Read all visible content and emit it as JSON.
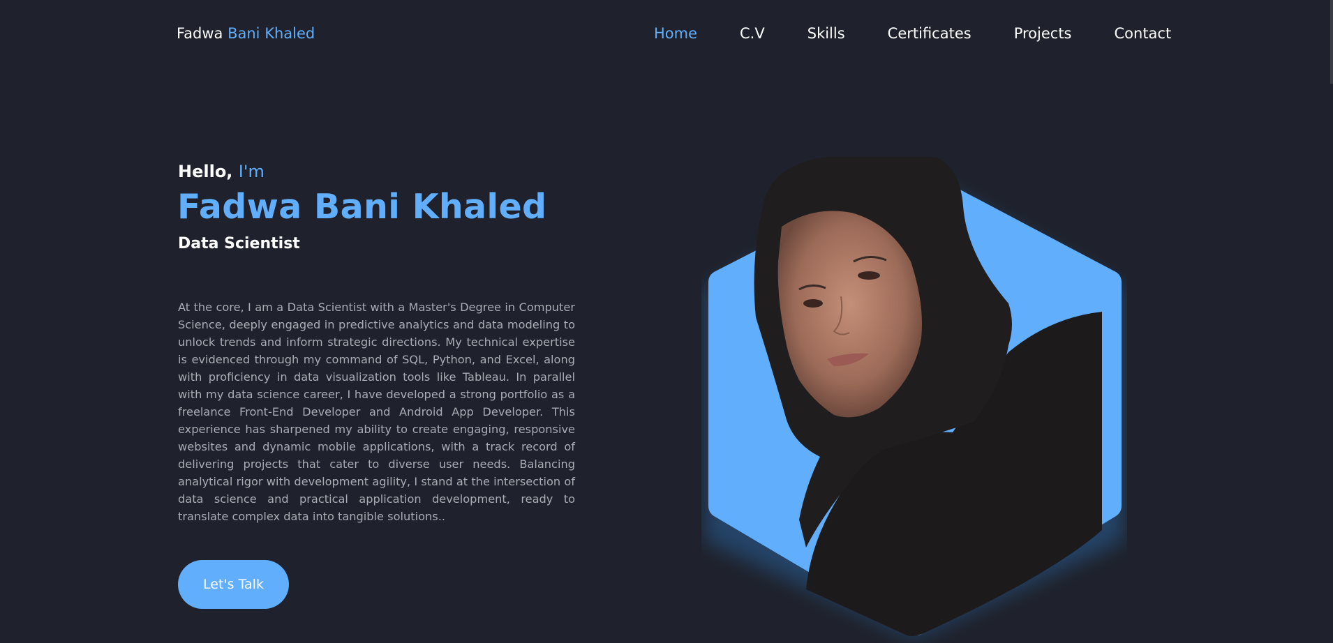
{
  "header": {
    "logo_first": "Fadwa",
    "logo_accent": "Bani Khaled"
  },
  "nav": {
    "items": [
      {
        "label": "Home",
        "active": true
      },
      {
        "label": "C.V",
        "active": false
      },
      {
        "label": "Skills",
        "active": false
      },
      {
        "label": "Certificates",
        "active": false
      },
      {
        "label": "Projects",
        "active": false
      },
      {
        "label": "Contact",
        "active": false
      }
    ]
  },
  "hero": {
    "greeting": "Hello,",
    "greeting_accent": "I'm",
    "name": "Fadwa Bani Khaled",
    "role": "Data Scientist",
    "about": "At the core, I am a Data Scientist with a Master's Degree in Computer Science, deeply engaged in predictive analytics and data modeling to unlock trends and inform strategic directions. My technical expertise is evidenced through my command of SQL, Python, and Excel, along with proficiency in data visualization tools like Tableau. In parallel with my data science career, I have developed a strong portfolio as a freelance Front-End Developer and Android App Developer. This experience has sharpened my ability to create engaging, responsive websites and dynamic mobile applications, with a track record of delivering projects that cater to diverse user needs. Balancing analytical rigor with development agility, I stand at the intersection of data science and practical application development, ready to translate complex data into tangible solutions..",
    "cta_label": "Let's Talk",
    "portrait_icon": "profile-photo"
  },
  "colors": {
    "background": "#1f222c",
    "accent": "#61aefc",
    "text": "#ffffff",
    "muted_text": "#a9acb3"
  }
}
